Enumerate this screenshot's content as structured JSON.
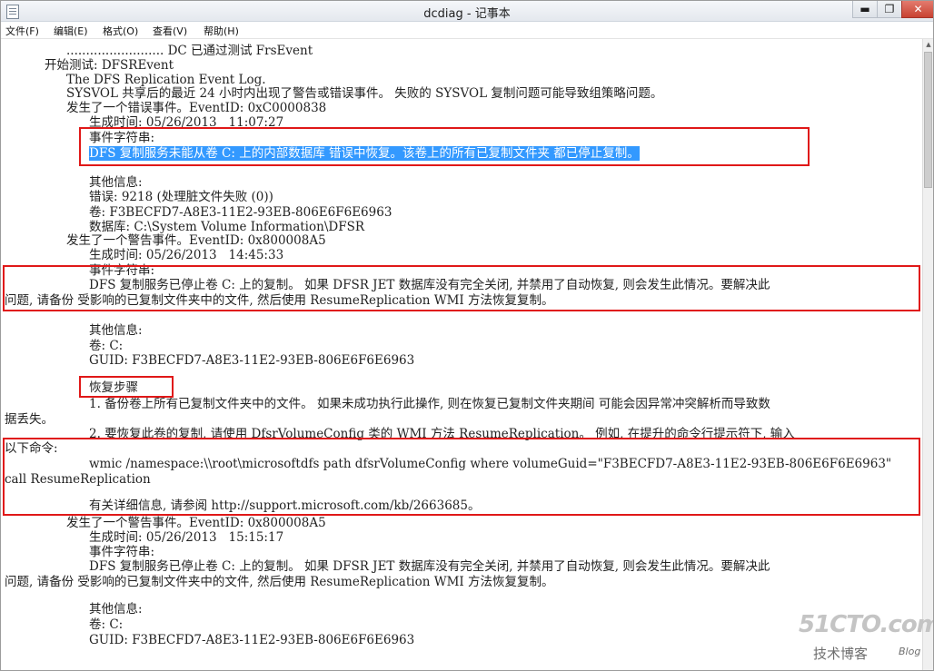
{
  "window": {
    "title": "dcdiag - 记事本",
    "controls": {
      "minimize": "▬",
      "maximize": "❐",
      "close": "✕"
    }
  },
  "menu": [
    "文件(F)",
    "编辑(E)",
    "格式(O)",
    "查看(V)",
    "帮助(H)"
  ],
  "lines": [
    "......................... DC 已通过测试 FrsEvent",
    "开始测试: DFSREvent",
    "The DFS Replication Event Log.",
    "SYSVOL 共享后的最近 24 小时内出现了警告或错误事件。 失败的 SYSVOL 复制问题可能导致组策略问题。",
    "发生了一个错误事件。EventID: 0xC0000838",
    "生成时间: 05/26/2013   11:07:27",
    "事件字符串:",
    "DFS 复制服务未能从卷 C: 上的内部数据库 错误中恢复。该卷上的所有已复制文件夹 都已停止复制。",
    "其他信息:",
    "错误: 9218 (处理脏文件失败 (0))",
    "卷: F3BECFD7-A8E3-11E2-93EB-806E6F6E6963",
    "数据库: C:\\System Volume Information\\DFSR",
    "发生了一个警告事件。EventID: 0x800008A5",
    "生成时间: 05/26/2013   14:45:33",
    "事件字符串:",
    "DFS 复制服务已停止卷 C: 上的复制。 如果 DFSR JET 数据库没有完全关闭, 并禁用了自动恢复, 则会发生此情况。要解决此",
    "问题, 请备份 受影响的已复制文件夹中的文件, 然后使用 ResumeReplication WMI 方法恢复复制。",
    "其他信息:",
    "卷: C:",
    "GUID: F3BECFD7-A8E3-11E2-93EB-806E6F6E6963",
    "恢复步骤",
    "1. 备份卷上所有已复制文件夹中的文件。 如果未成功执行此操作, 则在恢复已复制文件夹期间 可能会因异常冲突解析而导致数",
    "据丢失。",
    "2. 要恢复此卷的复制, 请使用 DfsrVolumeConfig 类的 WMI 方法 ResumeReplication。 例如, 在提升的命令行提示符下, 输入",
    "以下命令:",
    "wmic /namespace:\\\\root\\microsoftdfs path dfsrVolumeConfig where volumeGuid=\"F3BECFD7-A8E3-11E2-93EB-806E6F6E6963\"",
    "call ResumeReplication",
    "有关详细信息, 请参阅 http://support.microsoft.com/kb/2663685。",
    "发生了一个警告事件。EventID: 0x800008A5",
    "生成时间: 05/26/2013   15:15:17",
    "事件字符串:",
    "DFS 复制服务已停止卷 C: 上的复制。 如果 DFSR JET 数据库没有完全关闭, 并禁用了自动恢复, 则会发生此情况。要解决此",
    "问题, 请备份 受影响的已复制文件夹中的文件, 然后使用 ResumeReplication WMI 方法恢复复制。",
    "其他信息:",
    "卷: C:",
    "GUID: F3BECFD7-A8E3-11E2-93EB-806E6F6E6963"
  ],
  "watermark": {
    "main": "51CTO.com",
    "sub": "技术博客",
    "blog": "Blog"
  },
  "colors": {
    "selection": "#3399ff",
    "highlight_box": "#e01818"
  }
}
